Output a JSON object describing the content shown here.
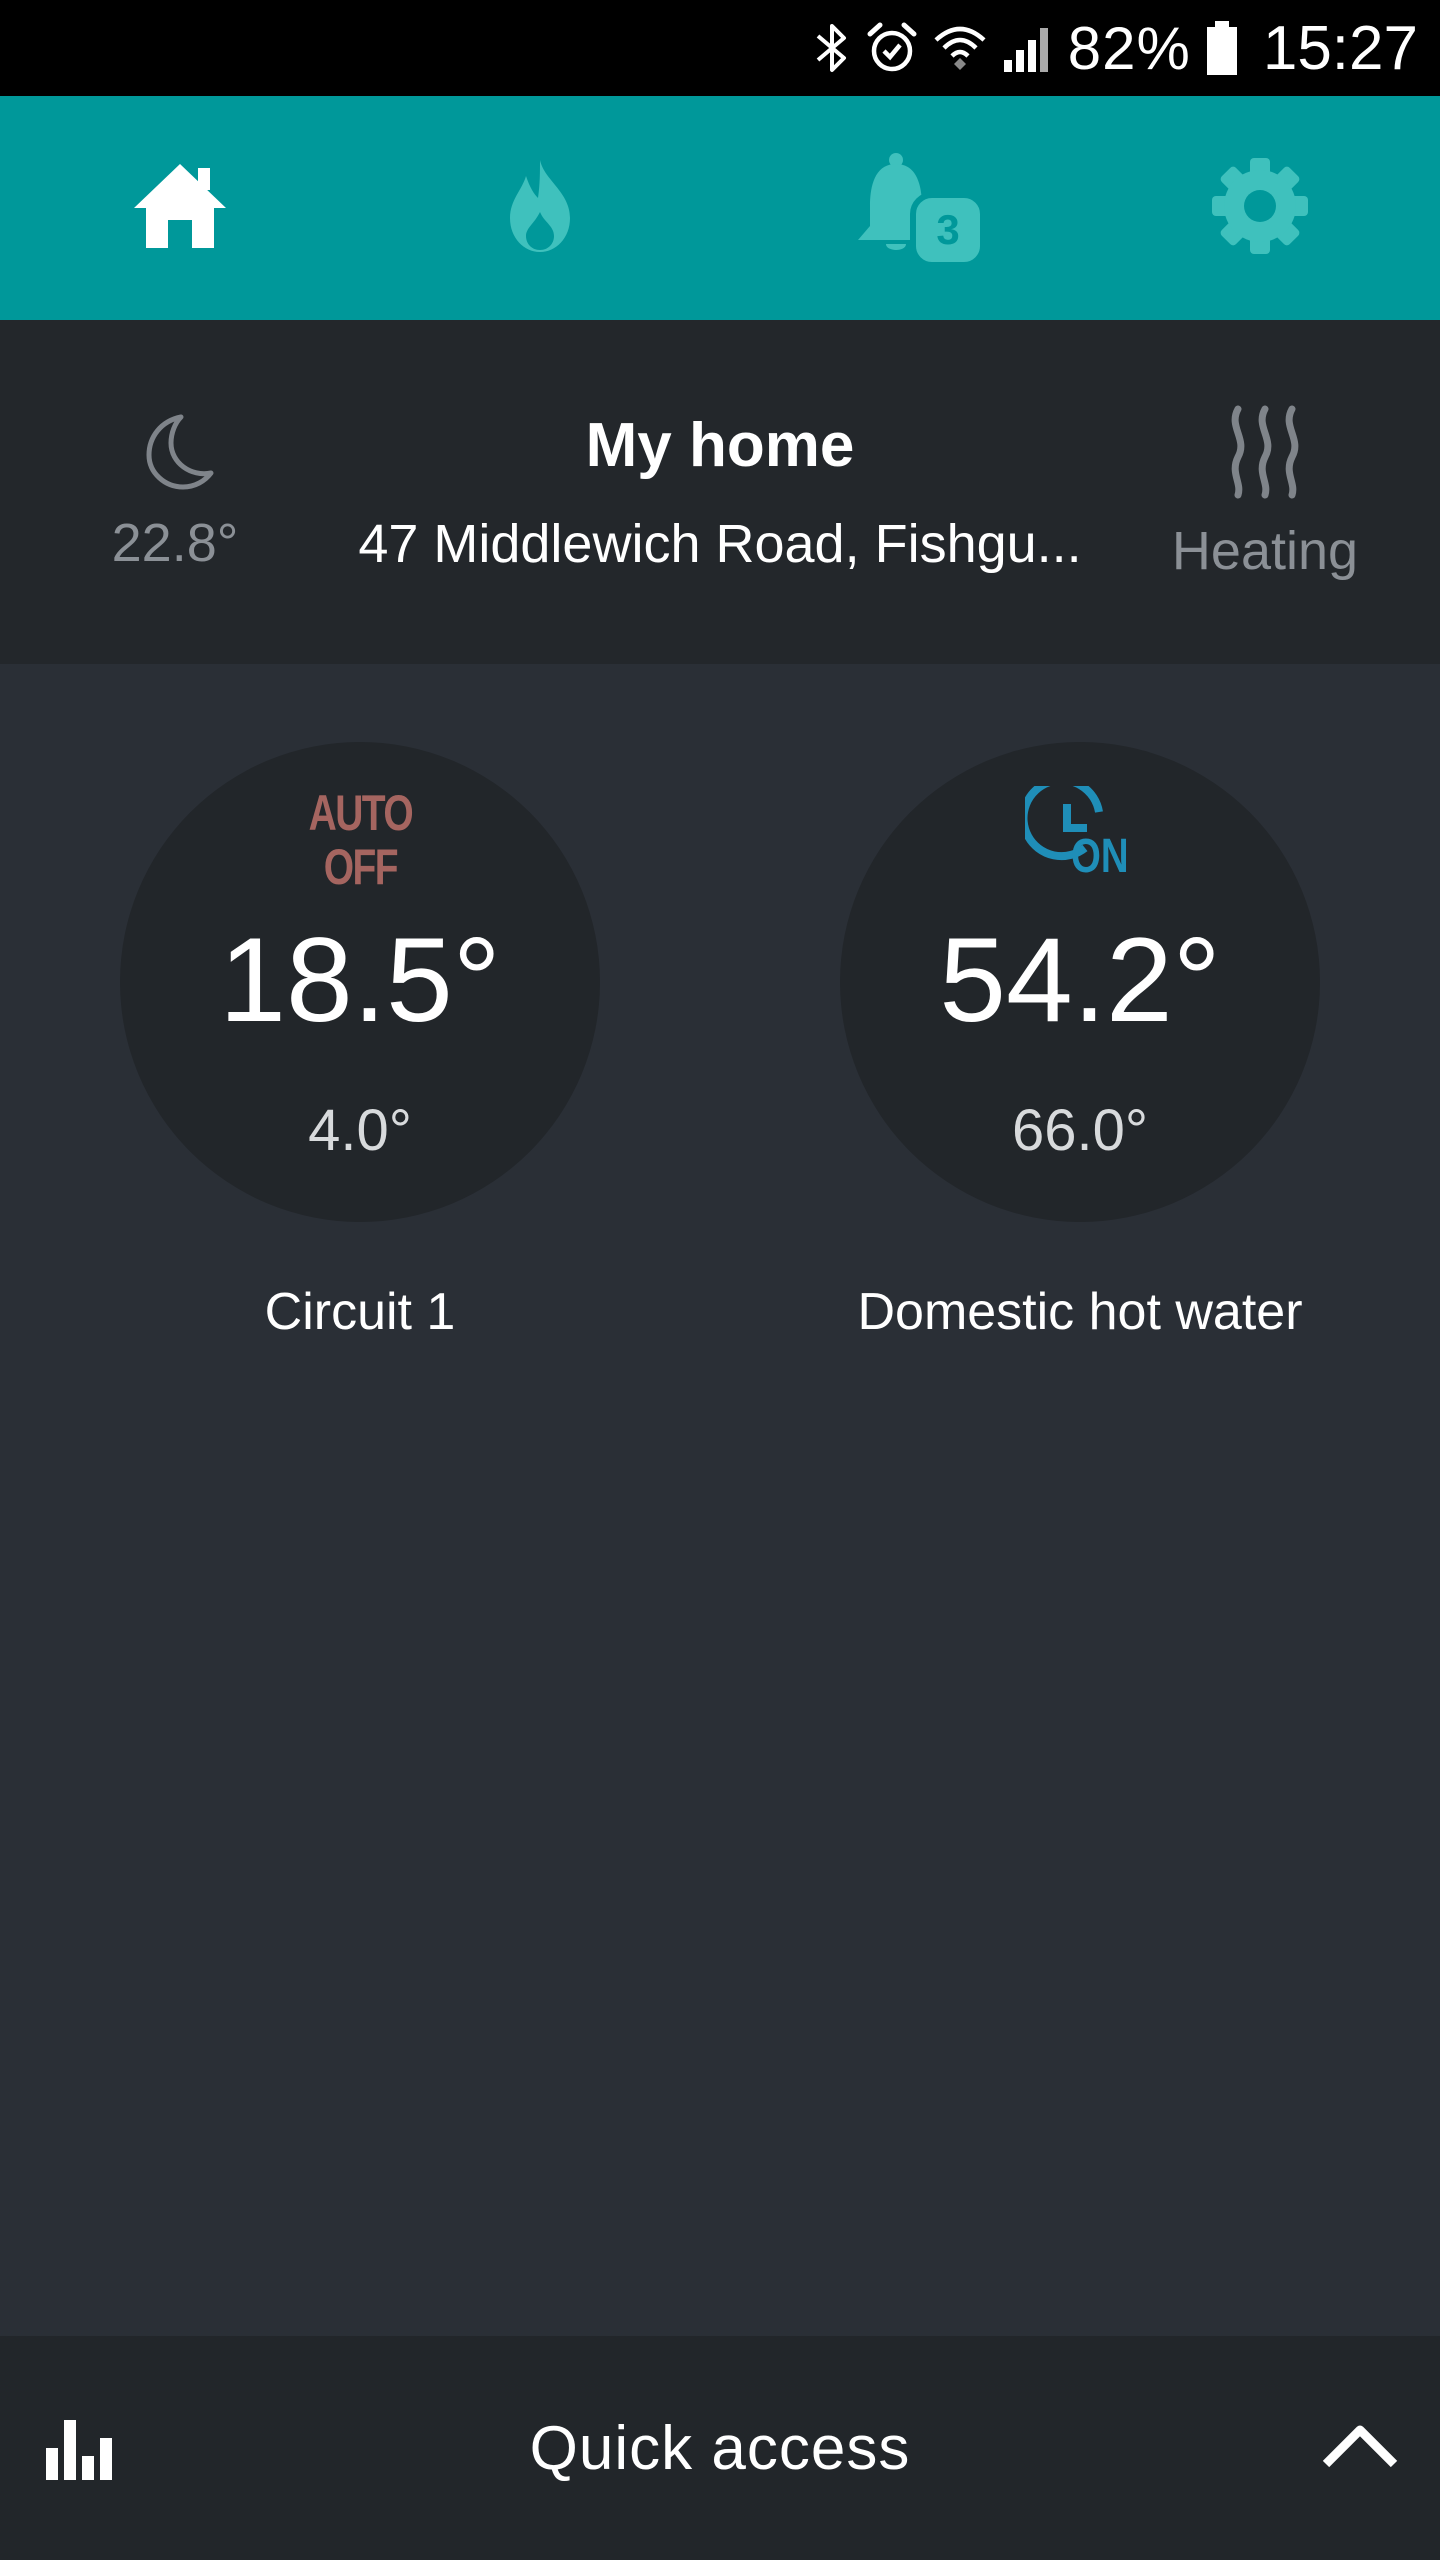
{
  "status_bar": {
    "icons": [
      "bluetooth-icon",
      "alarm-icon",
      "wifi-icon",
      "signal-icon",
      "battery-icon"
    ],
    "battery": "82%",
    "time": "15:27"
  },
  "nav": {
    "items": [
      {
        "name": "home",
        "icon": "home-icon",
        "active": true
      },
      {
        "name": "heating",
        "icon": "flame-icon",
        "active": false
      },
      {
        "name": "notifications",
        "icon": "bell-icon",
        "active": false,
        "badge": "3"
      },
      {
        "name": "settings",
        "icon": "gear-icon",
        "active": false
      }
    ],
    "colors": {
      "bar": "#00989a",
      "active": "#ffffff",
      "inactive": "#3fc1bd"
    }
  },
  "home": {
    "title": "My home",
    "address": "47 Middlewich Road, Fishgu...",
    "outdoor": {
      "icon": "moon-icon",
      "temp": "22.8°"
    },
    "system_mode": {
      "icon": "heat-waves-icon",
      "label": "Heating"
    }
  },
  "circuits": [
    {
      "name": "Circuit 1",
      "mode": {
        "icon": "auto-off-icon",
        "lines": [
          "AUTO",
          "OFF"
        ],
        "color": "#a56560"
      },
      "current_temp": "18.5°",
      "set_temp": "4.0°"
    },
    {
      "name": "Domestic hot water",
      "mode": {
        "icon": "clock-on-icon",
        "label": "ON",
        "color": "#1f8eb8"
      },
      "current_temp": "54.2°",
      "set_temp": "66.0°"
    }
  ],
  "bottom_bar": {
    "left_icon": "bar-chart-icon",
    "label": "Quick access",
    "right_icon": "chevron-up-icon"
  }
}
